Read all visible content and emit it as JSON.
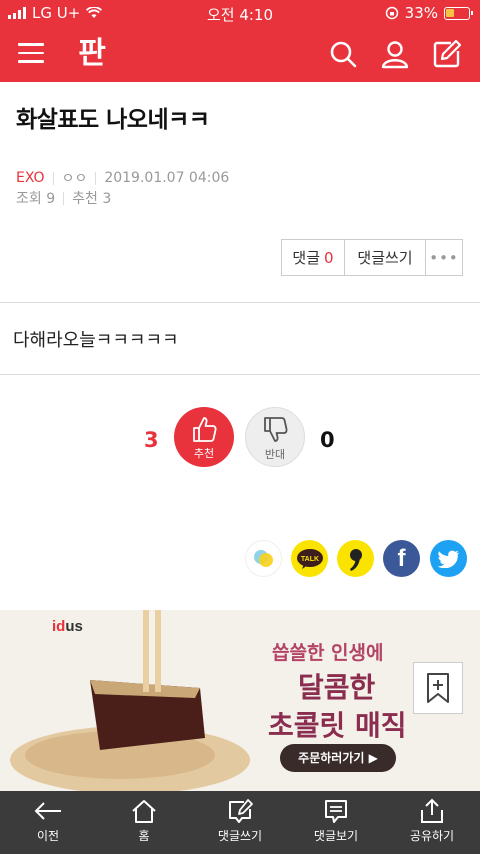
{
  "status": {
    "carrier": "LG U+",
    "time": "오전 4:10",
    "battery": "33%"
  },
  "header": {
    "logo": "판"
  },
  "post": {
    "title": "화살표도 나오네ㅋㅋ",
    "category": "EXO",
    "author": "ㅇㅇ",
    "datetime": "2019.01.07 04:06",
    "views": "조회 9",
    "recommends": "추천 3",
    "body": "다해라오늘ㅋㅋㅋㅋㅋ"
  },
  "actions": {
    "comment_label": "댓글",
    "comment_count": "0",
    "write_label": "댓글쓰기",
    "more_label": "•••"
  },
  "vote": {
    "up_count": "3",
    "up_label": "추천",
    "down_count": "0",
    "down_label": "반대"
  },
  "share": {
    "facebook_glyph": "f"
  },
  "ad": {
    "brand_a": "id",
    "brand_b": "us",
    "line1": "씁쓸한 인생에",
    "line2": "달콤한",
    "line3": "초콜릿 매직",
    "cta": "주문하러가기 ▶"
  },
  "bottom_nav": [
    {
      "label": "이전"
    },
    {
      "label": "홈"
    },
    {
      "label": "댓글쓰기"
    },
    {
      "label": "댓글보기"
    },
    {
      "label": "공유하기"
    }
  ],
  "colors": {
    "brand": "#e8323c",
    "bottom_bar": "#3b3b3b"
  }
}
